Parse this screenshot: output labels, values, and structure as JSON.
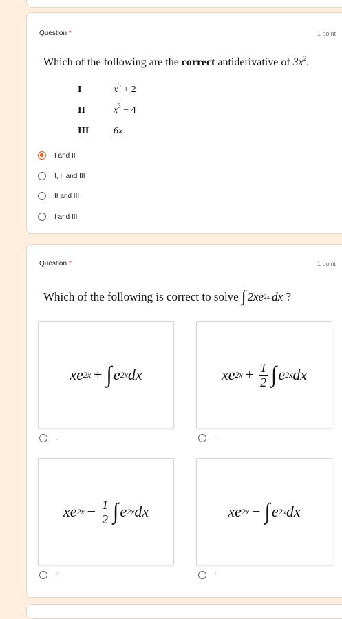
{
  "questions": [
    {
      "label": "Question",
      "required": "*",
      "points": "1 point",
      "text_prefix": "Which  of the following are the ",
      "text_bold": "correct",
      "text_suffix": " antiderivative of ",
      "expr_base": "3x",
      "expr_exp": "2",
      "text_end": ".",
      "statements": [
        {
          "roman": "I",
          "base": "x",
          "exp": "3",
          "rest": " + 2"
        },
        {
          "roman": "II",
          "base": "x",
          "exp": "3",
          "rest": " − 4"
        },
        {
          "roman": "III",
          "base": "6x",
          "exp": "",
          "rest": ""
        }
      ],
      "options": [
        {
          "label": "I and II",
          "selected": true
        },
        {
          "label": "I, II and III",
          "selected": false
        },
        {
          "label": "II and III",
          "selected": false
        },
        {
          "label": "I and III",
          "selected": false
        }
      ]
    },
    {
      "label": "Question",
      "required": "*",
      "points": "1 point",
      "text_prefix": "Which of the following is correct to solve ",
      "int_sign": "∫",
      "integrand": "2xe",
      "integrand_exp": "2x",
      "dx": "dx",
      "text_end": " ?",
      "choices": [
        {
          "base": "xe",
          "exp": "2x",
          "op": "+",
          "frac_num": "",
          "frac_den": "",
          "int": "∫",
          "ibase": "e",
          "iexp": "2x",
          "dx": "dx",
          "option_label": "."
        },
        {
          "base": "xe",
          "exp": "2x",
          "op": "+",
          "frac_num": "1",
          "frac_den": "2",
          "int": "∫",
          "ibase": "e",
          "iexp": "2x",
          "dx": "dx",
          "option_label": "'"
        },
        {
          "base": "xe",
          "exp": "2x",
          "op": "−",
          "frac_num": "1",
          "frac_den": "2",
          "int": "∫",
          "ibase": "e",
          "iexp": "2x",
          "dx": "dx",
          "option_label": "\""
        },
        {
          "base": "xe",
          "exp": "2x",
          "op": "−",
          "frac_num": "",
          "frac_den": "",
          "int": "∫",
          "ibase": "e",
          "iexp": "2x",
          "dx": "dx",
          "option_label": "`"
        }
      ]
    }
  ],
  "colors": {
    "background": "#fdeedd",
    "accent": "#e8571a",
    "required": "#d93025"
  }
}
